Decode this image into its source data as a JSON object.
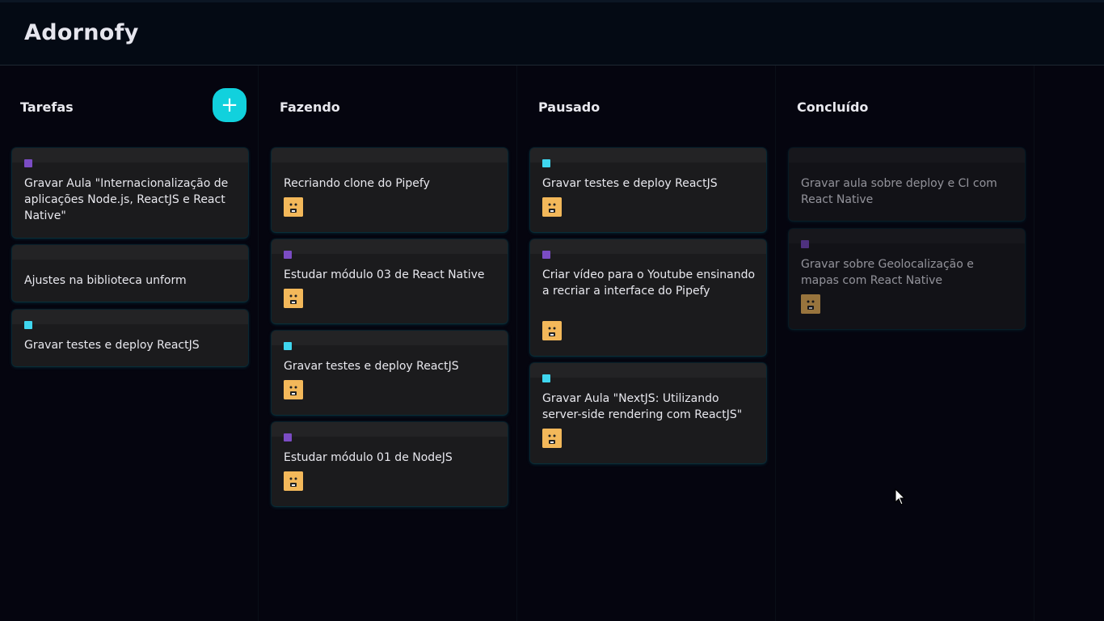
{
  "app": {
    "title": "Adornofy"
  },
  "colors": {
    "purple": "#7b4cc4",
    "cyan": "#3fd6ef",
    "accent": "#11d1dd"
  },
  "lists": [
    {
      "title": "Tarefas",
      "add_button": "+",
      "cards": [
        {
          "text": "Gravar Aula \"Internacionalização de aplicações Node.js, ReactJS e React Native\"",
          "label": "purple"
        },
        {
          "text": "Ajustes na biblioteca unform"
        },
        {
          "text": "Gravar testes e deploy ReactJS",
          "label": "cyan"
        }
      ]
    },
    {
      "title": "Fazendo",
      "cards": [
        {
          "text": "Recriando clone do Pipefy",
          "avatar": "user-avatar"
        },
        {
          "text": "Estudar módulo 03 de React Native",
          "label": "purple",
          "avatar": "user-avatar"
        },
        {
          "text": "Gravar testes e deploy ReactJS",
          "label": "cyan",
          "avatar": "user-avatar"
        },
        {
          "text": "Estudar módulo 01 de NodeJS",
          "label": "purple",
          "avatar": "user-avatar"
        }
      ]
    },
    {
      "title": "Pausado",
      "cards": [
        {
          "text": "Gravar testes e deploy ReactJS",
          "label": "cyan",
          "avatar": "user-avatar"
        },
        {
          "text": "Criar vídeo para o Youtube ensinando a recriar a interface do Pipefy",
          "label": "purple",
          "avatar": "user-avatar"
        },
        {
          "text": "Gravar Aula \"NextJS: Utilizando server-side rendering com ReactJS\"",
          "label": "cyan",
          "avatar": "user-avatar"
        }
      ]
    },
    {
      "title": "Concluído",
      "done": true,
      "cards": [
        {
          "text": "Gravar aula sobre deploy e CI com React Native"
        },
        {
          "text": "Gravar sobre Geolocalização e mapas com React Native",
          "label": "purple",
          "avatar": "user-avatar"
        }
      ]
    }
  ]
}
